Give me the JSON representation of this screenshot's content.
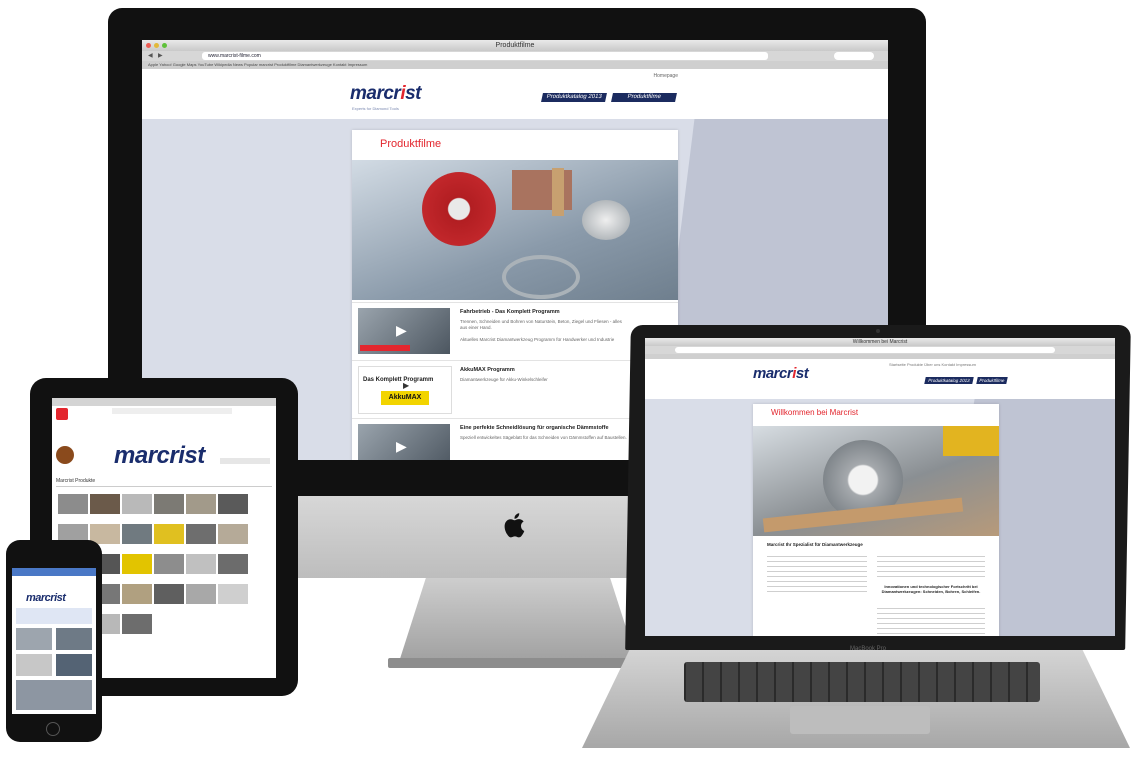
{
  "imac": {
    "window_title": "Produktfilme",
    "url": "www.marcrist-filme.com",
    "bookmarks": "Apple  Yahoo!  Google Maps  YouTube  Wikipedia  News  Popular  marcrist  Produktfilme  Diamantwerkzeuge  Kontakt  Impressum",
    "top_link": "Homepage",
    "logo_text_a": "marcr",
    "logo_text_i": "i",
    "logo_text_b": "st",
    "tagline": "Experts for Diamond Tools",
    "nav": [
      "Produktkatalog 2013",
      "Produktfilme"
    ],
    "page_title": "Produktfilme",
    "items": [
      {
        "title": "Fahrbetrieb - Das Komplett Programm",
        "text": "Trennen, Schneiden und Bohren von Naturstein, Beton, Ziegel und Fliesen - alles aus einer Hand.",
        "text2": "Aktuelles Marcrist Diamantwerkzeug Programm für Handwerker und Industrie"
      },
      {
        "title": "AkkuMAX Programm",
        "text": "Diamantwerkzeuge für Akku-Winkelschleifer"
      },
      {
        "title": "Eine perfekte Schneidlösung für organische Dämmstoffe",
        "text": "Speziell entwickeltes Sägeblatt für das Schneiden von Dämmstoffen auf Baustellen."
      }
    ],
    "thumb_labels": [
      "",
      "Das Komplett Programm",
      ""
    ],
    "akku_label": "AkkuMAX"
  },
  "macbook": {
    "window_title": "Willkommen bei Marcrist",
    "top_links": "Startseite  Produkte  Über uns  Kontakt  Impressum",
    "nav": [
      "Produktkatalog 2013",
      "Produktfilme"
    ],
    "page_title": "Willkommen bei Marcrist",
    "subheading": "Marcrist Ihr Spezialist für Diamantwerkzeuge",
    "bold_heading": "Innovationen und technologischer Fortschritt bei Diamantwerkzeugen: Schneiden, Bohren, Schleifen.",
    "label": "MacBook Pro"
  },
  "ipad": {
    "logo": "marcrist",
    "section_title": "Marcrist Produkte"
  },
  "iphone": {
    "logo": "marcrist"
  },
  "colors": {
    "brand_blue": "#1a2d6d",
    "brand_red": "#e3262e",
    "nav_bg": "#1b2b5f"
  }
}
